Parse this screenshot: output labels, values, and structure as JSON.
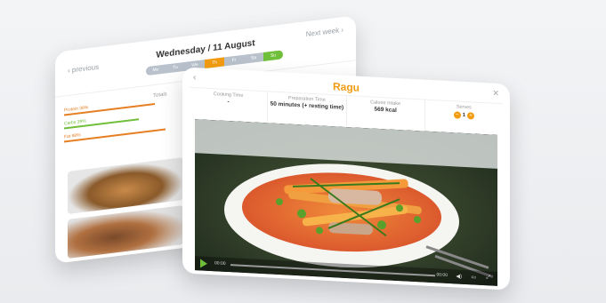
{
  "day_planner": {
    "prev_label": "‹ previous",
    "date_label": "Wednesday / 11 August",
    "next_label": "Next week ›",
    "days": [
      "Mo",
      "Tu",
      "We",
      "Th",
      "Fr",
      "Sa",
      "Su"
    ],
    "active_day_index": 3,
    "totals_label": "Totals",
    "macros": {
      "protein": "Protein 39%",
      "carbs": "Carbs 39%",
      "fat": "Fat 98%"
    }
  },
  "recipe": {
    "title": "Ragu",
    "stats": {
      "cooking_time_label": "Cooking Time",
      "cooking_time_value": "-",
      "prep_time_label": "Preparation Time",
      "prep_time_value": "50 minutes (+ resting time)",
      "calorie_label": "Calorie Intake",
      "calorie_value": "569 kcal",
      "serves_label": "Serves",
      "serves_value": "1"
    },
    "video": {
      "time_elapsed": "00:00",
      "time_total": "00:00"
    }
  },
  "colors": {
    "accent": "#f39c12",
    "green": "#6fbf3a"
  }
}
